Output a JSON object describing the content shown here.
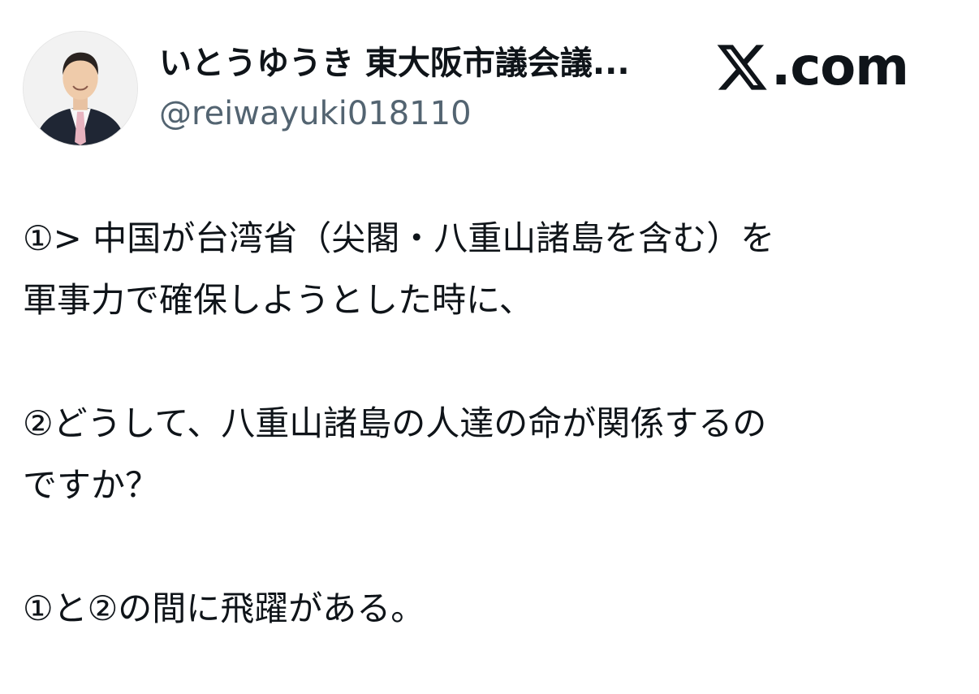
{
  "author": {
    "display_name": "いとうゆうき 東大阪市議会議...",
    "handle": "@reiwayuki018110",
    "avatar_icon": "profile-photo"
  },
  "brand": {
    "logo_icon": "x-logo-icon",
    "suffix": ".com"
  },
  "tweet": {
    "paragraphs": [
      {
        "lines": [
          "①> 中国が台湾省（尖閣・八重山諸島を含む）を",
          "軍事力で確保しようとした時に、"
        ]
      },
      {
        "lines": [
          "②どうして、八重山諸島の人達の命が関係するの",
          "ですか？"
        ]
      },
      {
        "lines": [
          "①と②の間に飛躍がある。"
        ]
      }
    ]
  }
}
